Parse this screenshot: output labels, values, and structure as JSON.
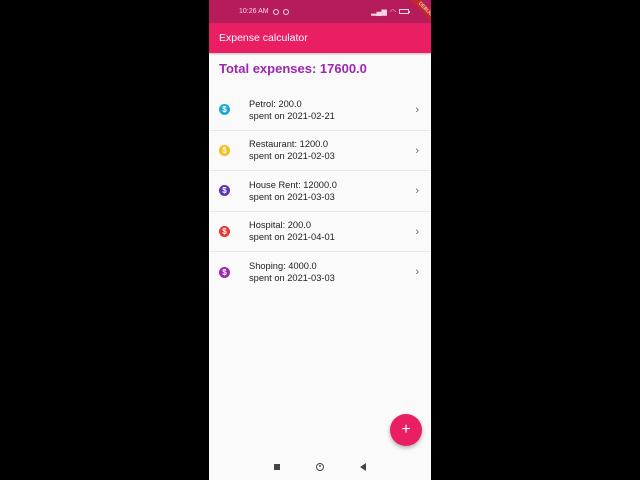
{
  "status_bar": {
    "time": "10:26 AM",
    "debug_banner": "DEBUG"
  },
  "app_bar": {
    "title": "Expense calculator"
  },
  "total": {
    "text": "Total expenses: 17600.0"
  },
  "expenses": [
    {
      "line1": "Petrol: 200.0",
      "line2": "spent on 2021-02-21",
      "color": "#1fa8d6"
    },
    {
      "line1": "Restaurant: 1200.0",
      "line2": "spent on 2021-02-03",
      "color": "#f2c01a"
    },
    {
      "line1": "House Rent: 12000.0",
      "line2": "spent on 2021-03-03",
      "color": "#5e35b1"
    },
    {
      "line1": "Hospital: 200.0",
      "line2": "spent on 2021-04-01",
      "color": "#e53935"
    },
    {
      "line1": "Shoping: 4000.0",
      "line2": "spent on 2021-03-03",
      "color": "#9c27b0"
    }
  ],
  "icons": {
    "item": "dollar-coin-icon",
    "chevron": "chevron-right-icon",
    "fab": "plus-icon"
  },
  "colors": {
    "primary": "#e91e63",
    "total_text": "#9c27b0",
    "status_bar": "#b71c5a"
  }
}
